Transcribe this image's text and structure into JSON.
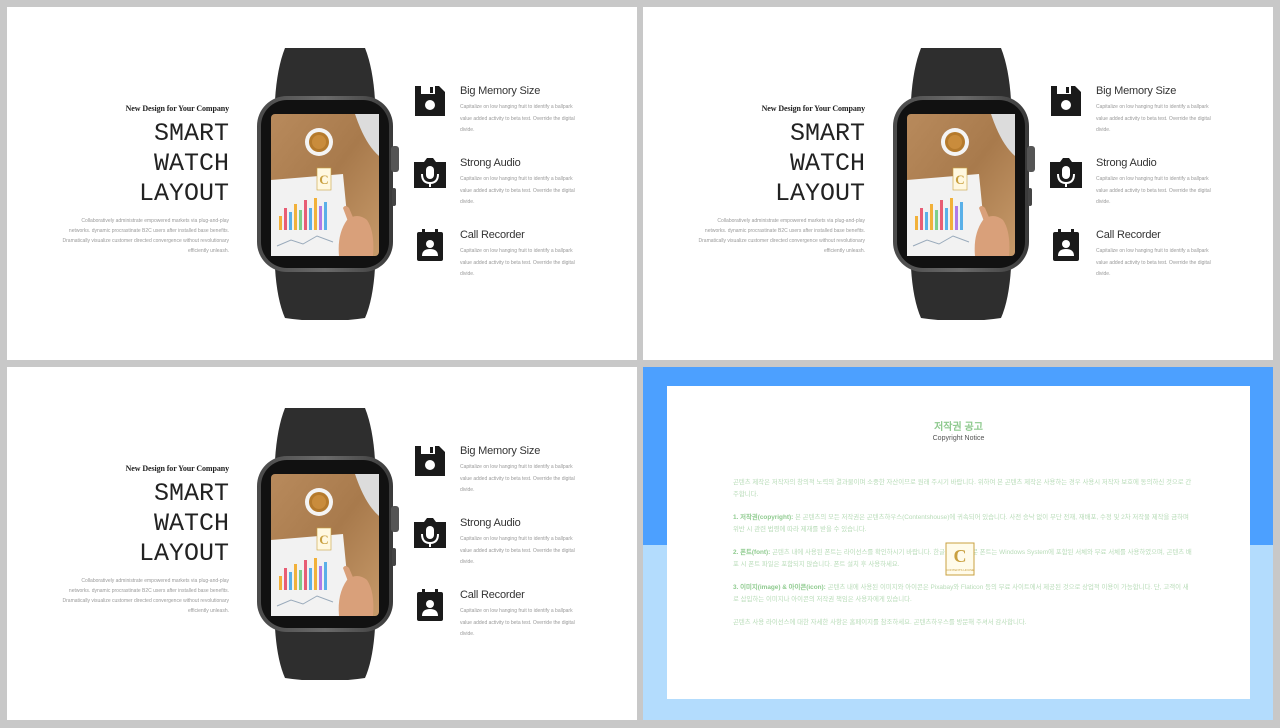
{
  "slides": [
    {
      "tagline": "New Design  for Your Company",
      "headline": [
        "SMART",
        "WATCH",
        "LAYOUT"
      ],
      "description": "Collaboratively administrate empowered markets via plug-and-play networks. dynamic procrastinate B2C users after installed base benefits. Dramatically visualize customer directed convergence without revolutionary efficiently unleash."
    },
    {
      "tagline": "New Design  for Your Company",
      "headline": [
        "SMART",
        "WATCH",
        "LAYOUT"
      ],
      "description": "Collaboratively administrate empowered markets via plug-and-play networks. dynamic procrastinate B2C users after installed base benefits. Dramatically visualize customer directed convergence without revolutionary efficiently unleash."
    },
    {
      "tagline": "New Design  for Your Company",
      "headline": [
        "SMART",
        "WATCH",
        "LAYOUT"
      ],
      "description": "Collaboratively administrate empowered markets via plug-and-play networks. dynamic procrastinate B2C users after installed base benefits. Dramatically visualize customer directed convergence without revolutionary efficiently unleash."
    }
  ],
  "features": [
    {
      "icon": "floppy-disk-icon",
      "title": "Big Memory Size",
      "text": "Capitalize on low hanging fruit to identify a ballpark value added activity to beta test. Override the digital divide."
    },
    {
      "icon": "microphone-icon",
      "title": "Strong Audio",
      "text": "Capitalize on low hanging fruit to identify a ballpark value added activity to beta test. Override the digital divide."
    },
    {
      "icon": "contact-recorder-icon",
      "title": "Call Recorder",
      "text": "Capitalize on low hanging fruit to identify a ballpark value added activity to beta test. Override the digital divide."
    }
  ],
  "notice": {
    "title": "저작권 공고",
    "subtitle": "Copyright Notice",
    "intro": "곤텐츠 제작은 저작자의 창의적 노력의 결과물이며 소중한 자산이므로 원래 주시기 바랍니다. 위하여 본 곤텐츠 제작은 사용하는 경우 사용시 저작자 보호에 동의하신 것으로 간주합니다.",
    "items": [
      {
        "head": "1. 저작권(copyright):",
        "text": "본 곤텐츠의 모든 저작권은 곤텐츠하우스(Contentshouse)에 귀속되어 있습니다. 사전 승낙 없이 무단 전재, 재배포, 수정 및 2차 저작물 제작을 금하며 위반 시 관련 법령에 따라 제재를 받을 수 있습니다."
      },
      {
        "head": "2. 폰트(font):",
        "text": "곤텐츠 내에 사용된 폰트는 라이선스를 확인하시기 바랍니다. 한글 폰트와 영문 폰트는 Windows System에 포함된 서체와 무료 서체를 사용하였으며, 곤텐츠 배포 시 폰트 파일은 포함되지 않습니다. 폰트 설치 후 사용하세요."
      },
      {
        "head": "3. 이미지(image) & 아이콘(icon):",
        "text": "곤텐츠 내에 사용된 이미지와 아이콘은 Pixabay와 Flaticon 등의 무료 사이트에서 제공된 것으로 상업적 이용이 가능합니다. 단, 고객이 새로 삽입하는 이미지나 아이콘의 저작권 책임은 사용자에게 있습니다."
      }
    ],
    "outro": "곤텐츠 사용 라이선스에 대한 자세한 사항은 홈페이지를 참조하세요. 곤텐츠하우스를 방문해 주셔서 감사합니다.",
    "logo_letter": "C",
    "logo_text": "CONTENTS HOUSE"
  },
  "colors": {
    "notice_blue": "#4ca0ff",
    "notice_light_blue": "#b3dcfd",
    "notice_green": "#8ec98e",
    "watch_body": "#2e2e2e"
  }
}
